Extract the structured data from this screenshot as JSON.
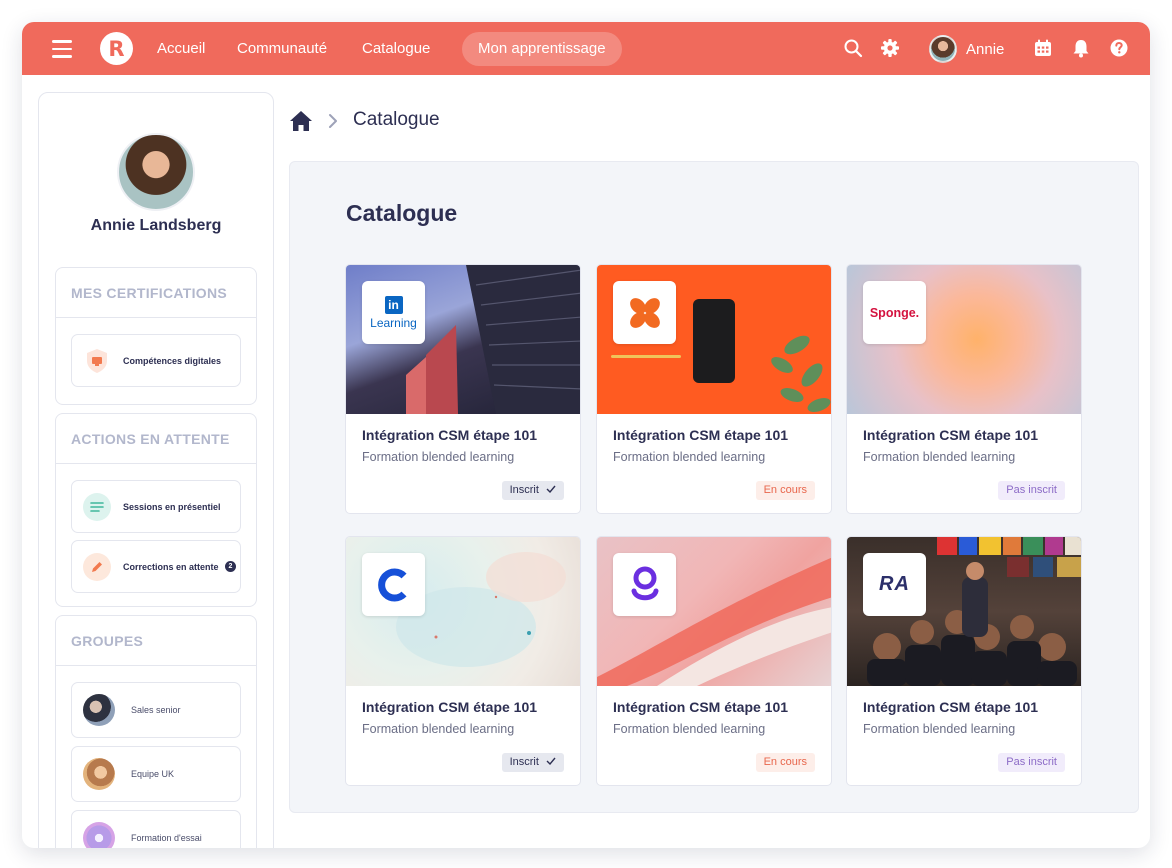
{
  "nav": {
    "items": [
      "Accueil",
      "Communauté",
      "Catalogue",
      "Mon apprentissage"
    ],
    "logo_letter": "R",
    "user_name": "Annie",
    "brand_color": "#f06a5c",
    "icons": [
      "menu-icon",
      "search-icon",
      "gear-icon",
      "calendar-icon",
      "bell-icon",
      "help-icon"
    ]
  },
  "profile": {
    "name": "Annie Landsberg"
  },
  "sidebar": {
    "certifications": {
      "title": "MES CERTIFICATIONS",
      "items": [
        {
          "label": "Compétences digitales"
        }
      ]
    },
    "pending": {
      "title": "ACTIONS EN ATTENTE",
      "items": [
        {
          "label": "Sessions en présentiel"
        },
        {
          "label": "Corrections en attente",
          "count": "2"
        }
      ]
    },
    "groups": {
      "title": "GROUPES",
      "items": [
        {
          "label": "Sales senior"
        },
        {
          "label": "Equipe UK"
        },
        {
          "label": "Formation d'essai"
        }
      ]
    }
  },
  "breadcrumb": {
    "current": "Catalogue"
  },
  "main": {
    "title": "Catalogue",
    "cards": [
      {
        "title": "Intégration CSM étape 101",
        "subtitle": "Formation blended learning",
        "status": "Inscrit",
        "brand": "LinkedIn Learning",
        "tile_text_top": "in",
        "tile_text_bottom": "Learning"
      },
      {
        "title": "Intégration CSM étape 101",
        "subtitle": "Formation blended learning",
        "status": "En cours",
        "brand": "X logo"
      },
      {
        "title": "Intégration CSM étape 101",
        "subtitle": "Formation blended learning",
        "status": "Pas inscrit",
        "brand": "Sponge",
        "tile_text": "Sponge."
      },
      {
        "title": "Intégration CSM étape 101",
        "subtitle": "Formation blended learning",
        "status": "Inscrit",
        "brand": "C logo"
      },
      {
        "title": "Intégration CSM étape 101",
        "subtitle": "Formation blended learning",
        "status": "En cours",
        "brand": "g logo"
      },
      {
        "title": "Intégration CSM étape 101",
        "subtitle": "Formation blended learning",
        "status": "Pas inscrit",
        "brand": "RA logo",
        "tile_text": "RA"
      }
    ]
  }
}
